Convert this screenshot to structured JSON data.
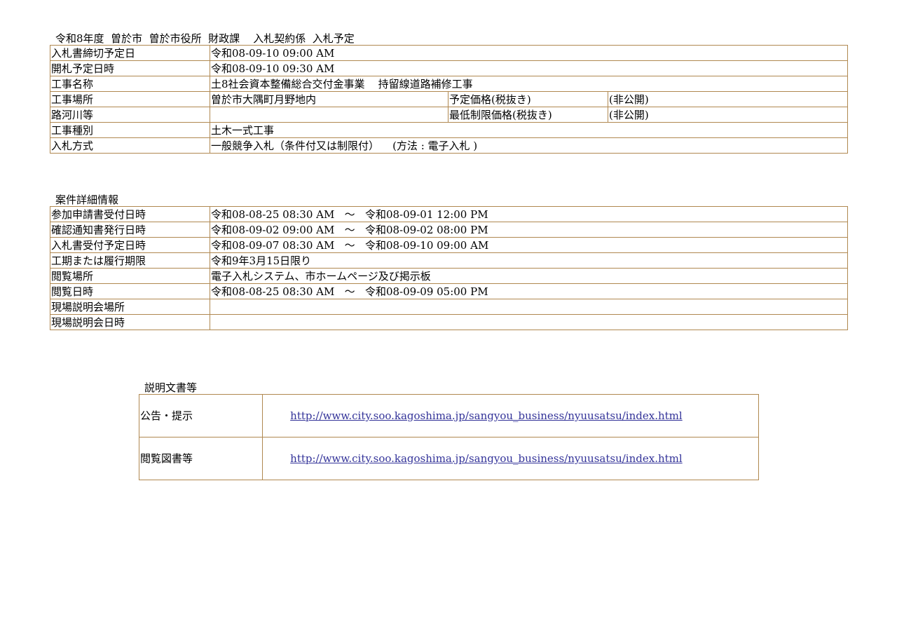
{
  "bid_info": {
    "caption": "令和8年度  曽於市  曽於市役所  財政課    入札契約係  入札予定",
    "rows": {
      "deadline": {
        "label": "入札書締切予定日",
        "value": "令和08-09-10 09:00 AM"
      },
      "opening": {
        "label": "開札予定日時",
        "value": "令和08-09-10 09:30 AM"
      },
      "name": {
        "label": "工事名称",
        "value": "土8社会資本整備総合交付金事業    持留線道路補修工事"
      },
      "location": {
        "label": "工事場所",
        "value": "曽於市大隅町月野地内",
        "sub_label": "予定価格(税抜き)",
        "sub_value": "(非公開)"
      },
      "road": {
        "label": "路河川等",
        "value": "",
        "sub_label": "最低制限価格(税抜き)",
        "sub_value": "(非公開)"
      },
      "type": {
        "label": "工事種別",
        "value": "土木一式工事"
      },
      "method": {
        "label": "入札方式",
        "value": "一般競争入札（条件付又は制限付）    (方法 : 電子入札 )"
      }
    }
  },
  "details": {
    "caption": "案件詳細情報",
    "rows": {
      "application": {
        "label": "参加申請書受付日時",
        "value": "令和08-08-25 08:30 AM   ～   令和08-09-01 12:00 PM"
      },
      "confirmation": {
        "label": "確認通知書発行日時",
        "value": "令和08-09-02 09:00 AM   ～   令和08-09-02 08:00 PM"
      },
      "submission": {
        "label": "入札書受付予定日時",
        "value": "令和08-09-07 08:30 AM   ～   令和08-09-10 09:00 AM"
      },
      "period": {
        "label": "工期または履行期限",
        "value": "令和9年3月15日限り"
      },
      "view_place": {
        "label": "閲覧場所",
        "value": "電子入札システム、市ホームページ及び掲示板"
      },
      "view_date": {
        "label": "閲覧日時",
        "value": "令和08-08-25 08:30 AM   ～   令和08-09-09 05:00 PM"
      },
      "briefing_place": {
        "label": "現場説明会場所",
        "value": ""
      },
      "briefing_date": {
        "label": "現場説明会日時",
        "value": ""
      }
    }
  },
  "documents": {
    "caption": "説明文書等",
    "rows": {
      "notice": {
        "label": "公告・提示",
        "url": "http://www.city.soo.kagoshima.jp/sangyou_business/nyuusatsu/index.html"
      },
      "drawings": {
        "label": "閲覧図書等",
        "url": "http://www.city.soo.kagoshima.jp/sangyou_business/nyuusatsu/index.html"
      }
    }
  },
  "colors": {
    "border": "#b08850",
    "link": "#333399"
  }
}
